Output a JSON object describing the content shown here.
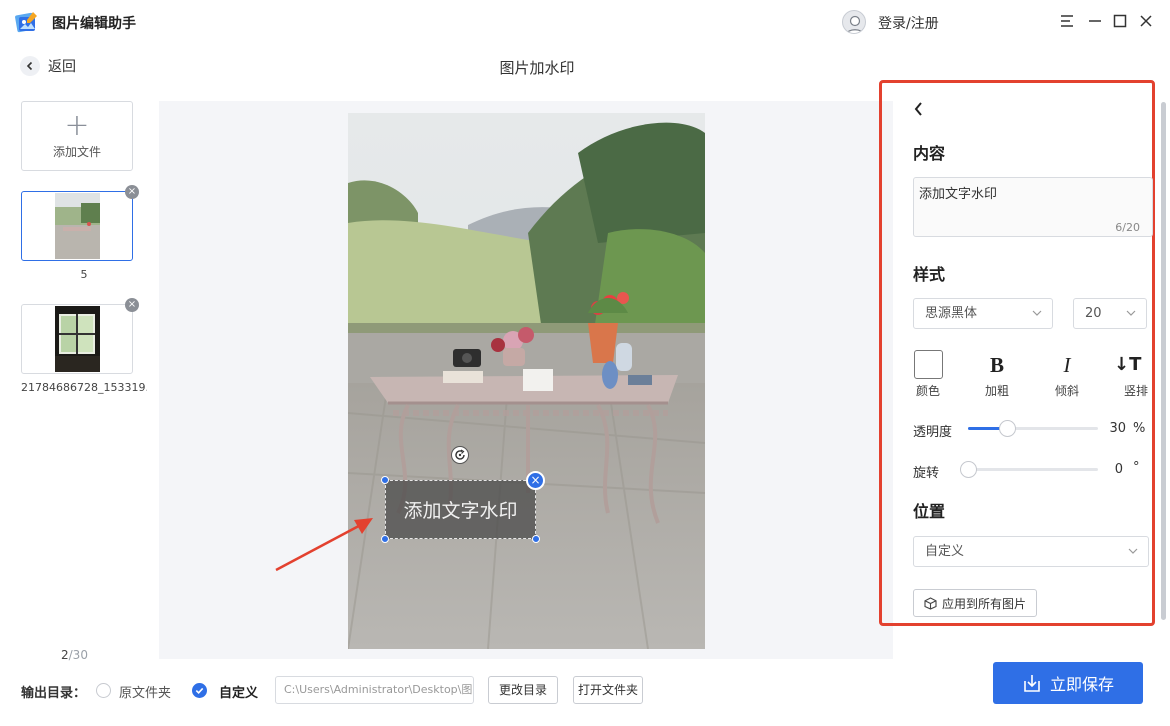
{
  "app": {
    "title": "图片编辑助手"
  },
  "header": {
    "login_label": "登录/注册"
  },
  "nav": {
    "back_label": "返回",
    "page_title": "图片加水印"
  },
  "files": {
    "add_label": "添加文件",
    "items": [
      {
        "name": "5",
        "active": true
      },
      {
        "name": "21784686728_153319..."
      }
    ],
    "page_current": "2",
    "page_total": "/30"
  },
  "watermark": {
    "text": "添加文字水印"
  },
  "panel": {
    "content_title": "内容",
    "content_value": "添加文字水印",
    "content_count": "6/20",
    "style_title": "样式",
    "font": "思源黑体",
    "size": "20",
    "style_buttons": [
      {
        "glyph": "",
        "label": "颜色"
      },
      {
        "glyph": "B",
        "label": "加粗"
      },
      {
        "glyph": "I",
        "label": "倾斜"
      },
      {
        "glyph": "↓T",
        "label": "竖排"
      }
    ],
    "opacity_label": "透明度",
    "opacity_value": "30",
    "opacity_unit": "%",
    "rotate_label": "旋转",
    "rotate_value": "0",
    "rotate_unit": "°",
    "position_title": "位置",
    "position_value": "自定义",
    "apply_label": "应用到所有图片",
    "accent": "#2f6fe6",
    "highlight": "#e3412f"
  },
  "output": {
    "label": "输出目录：",
    "option_original": "原文件夹",
    "option_custom": "自定义",
    "selected": "自定义",
    "path": "C:\\Users\\Administrator\\Desktop\\图",
    "change_dir_label": "更改目录",
    "open_folder_label": "打开文件夹",
    "save_label": "立即保存"
  }
}
